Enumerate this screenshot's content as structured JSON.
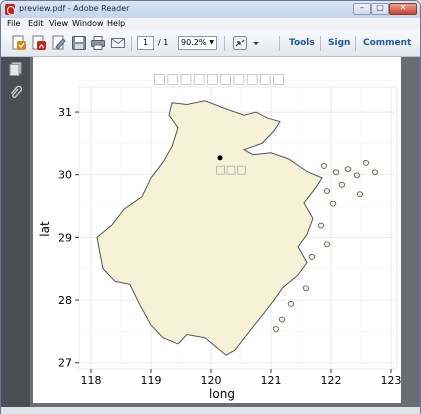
{
  "window": {
    "title": "preview.pdf - Adobe Reader",
    "minimize_symbol": "–",
    "maximize_symbol": "□",
    "close_symbol": "✕"
  },
  "menu": {
    "items": [
      "File",
      "Edit",
      "View",
      "Window",
      "Help"
    ]
  },
  "toolbar": {
    "current_page": "1",
    "page_total": "/ 1",
    "zoom": "90.2%",
    "tools_label": "Tools",
    "sign_label": "Sign",
    "comment_label": "Comment",
    "icons": [
      "create-pdf-icon",
      "convert-pdf-icon",
      "edit-icon",
      "save-icon",
      "print-icon",
      "email-icon",
      "page-navigation-icon",
      "dropdown-icon"
    ]
  },
  "navpane": {
    "icons": [
      "pages-icon",
      "attachments-icon"
    ]
  },
  "chart_data": {
    "type": "map",
    "title": "□□□□□□□□□□",
    "xlabel": "long",
    "ylabel": "lat",
    "x_ticks": [
      "118",
      "119",
      "120",
      "121",
      "122",
      "123"
    ],
    "y_ticks": [
      "27",
      "28",
      "29",
      "30",
      "31"
    ],
    "xlim": [
      117.8,
      123.1
    ],
    "ylim": [
      26.9,
      31.4
    ],
    "region_fill": "#f6f2d8",
    "region_stroke": "#555555",
    "panel_background": "#ffffff",
    "grid_color": "#ebebeb",
    "points": [
      {
        "x": 120.15,
        "y": 30.27,
        "label": "□□□"
      }
    ]
  }
}
